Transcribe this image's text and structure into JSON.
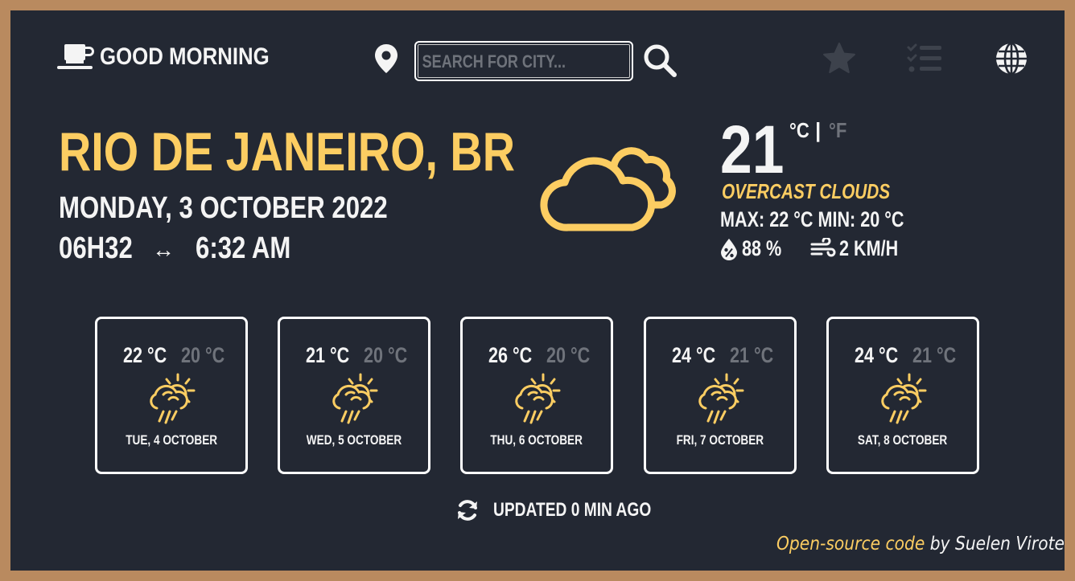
{
  "header": {
    "greeting": "GOOD MORNING",
    "search_placeholder": "SEARCH FOR CITY...",
    "search_value": "",
    "icons": [
      "coffee-cup-icon",
      "map-pin-icon",
      "search-icon",
      "star-icon",
      "checklist-icon",
      "globe-icon"
    ]
  },
  "location": {
    "city": "RIO DE JANEIRO, BR",
    "date": "MONDAY, 3 OCTOBER 2022",
    "time_24h": "06H32",
    "arrow": "↔",
    "time_12h": "6:32 AM"
  },
  "current": {
    "temperature": "21",
    "unit_celsius": "°C",
    "unit_separator": "|",
    "unit_fahrenheit": "°F",
    "active_unit": "celsius",
    "description": "OVERCAST CLOUDS",
    "max_min": "MAX: 22 °C  MIN: 20 °C",
    "humidity": "88 %",
    "wind": "2 KM/H",
    "icon": "cloud-icon"
  },
  "forecast": [
    {
      "max": "22 °C",
      "min": "20 °C",
      "date": "TUE, 4 OCTOBER",
      "icon": "sun-rain-cloud-icon"
    },
    {
      "max": "21 °C",
      "min": "20 °C",
      "date": "WED, 5 OCTOBER",
      "icon": "sun-rain-cloud-icon"
    },
    {
      "max": "26 °C",
      "min": "20 °C",
      "date": "THU, 6 OCTOBER",
      "icon": "sun-rain-cloud-icon"
    },
    {
      "max": "24 °C",
      "min": "21 °C",
      "date": "FRI, 7 OCTOBER",
      "icon": "sun-rain-cloud-icon"
    },
    {
      "max": "24 °C",
      "min": "21 °C",
      "date": "SAT, 8 OCTOBER",
      "icon": "sun-rain-cloud-icon"
    }
  ],
  "footer": {
    "updated": "UPDATED 0 MIN AGO",
    "credit_link": "Open-source code",
    "credit_by": " by Suelen Virote"
  },
  "colors": {
    "background": "#232833",
    "frame": "#b98a5f",
    "accent": "#fccd62",
    "text": "#f4f4f4",
    "muted": "#6f737b"
  }
}
